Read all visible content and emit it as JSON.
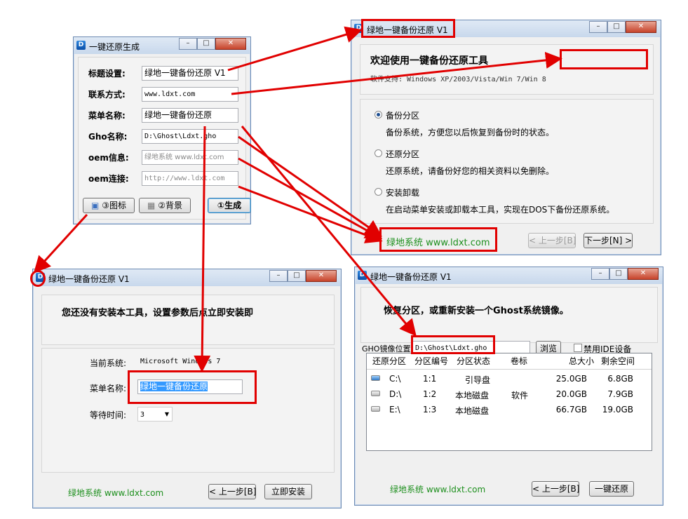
{
  "config_window": {
    "title": "一键还原生成",
    "fields": [
      {
        "label": "标题设置:",
        "value": "绿地一键备份还原 V1"
      },
      {
        "label": "联系方式:",
        "value": "www.ldxt.com"
      },
      {
        "label": "菜单名称:",
        "value": "绿地一键备份还原"
      },
      {
        "label": "Gho名称:",
        "value": "D:\\Ghost\\Ldxt.gho"
      },
      {
        "label": "oem信息:",
        "value": "绿地系统 www.ldxt.com"
      },
      {
        "label": "oem连接:",
        "value": "http://www.ldxt.com"
      }
    ],
    "buttons": {
      "icon": "③图标",
      "background": "②背景",
      "generate": "①生成"
    }
  },
  "main_window": {
    "title": "绿地一键备份还原 V1",
    "welcome": "欢迎使用一键备份还原工具",
    "support": "软件支持: Windows XP/2003/Vista/Win 7/Win 8",
    "options": [
      {
        "label": "备份分区",
        "desc": "备份系统，方便您以后恢复到备份时的状态。",
        "selected": true
      },
      {
        "label": "还原分区",
        "desc": "还原系统，请备份好您的相关资料以免删除。",
        "selected": false
      },
      {
        "label": "安装卸载",
        "desc": "在启动菜单安装或卸载本工具，实现在DOS下备份还原系统。",
        "selected": false
      }
    ],
    "oem": "绿地系统 www.ldxt.com",
    "prev": "< 上一步[B]",
    "next": "下一步[N] >"
  },
  "install_window": {
    "title": "绿地一键备份还原 V1",
    "heading": "您还没有安装本工具，设置参数后点立即安装即",
    "os_label": "当前系统:",
    "os_value": "Microsoft Windows 7",
    "menu_label": "菜单名称:",
    "menu_value": "绿地一键备份还原",
    "wait_label": "等待时间:",
    "wait_value": "3",
    "oem": "绿地系统 www.ldxt.com",
    "prev": "< 上一步[B]",
    "install": "立即安装"
  },
  "restore_window": {
    "title": "绿地一键备份还原 V1",
    "heading": "恢复分区，或重新安装一个Ghost系统镜像。",
    "gho_label": "GHO镜像位置",
    "gho_value": "D:\\Ghost\\Ldxt.gho",
    "browse": "浏览",
    "disable_ide": "禁用IDE设备",
    "columns": [
      "还原分区",
      "分区编号",
      "分区状态",
      "卷标",
      "总大小",
      "剩余空间"
    ],
    "rows": [
      {
        "drive": "C:\\",
        "num": "1:1",
        "state": "引导盘",
        "label": "",
        "total": "25.0GB",
        "free": "6.8GB"
      },
      {
        "drive": "D:\\",
        "num": "1:2",
        "state": "本地磁盘",
        "label": "软件",
        "total": "20.0GB",
        "free": "7.9GB"
      },
      {
        "drive": "E:\\",
        "num": "1:3",
        "state": "本地磁盘",
        "label": "",
        "total": "66.7GB",
        "free": "19.0GB"
      }
    ],
    "oem": "绿地系统 www.ldxt.com",
    "prev": "< 上一步[B]",
    "restore": "一键还原"
  },
  "colors": {
    "highlight": "#e10000",
    "oem_text": "#1d8f1d",
    "selection": "#3399ff"
  }
}
